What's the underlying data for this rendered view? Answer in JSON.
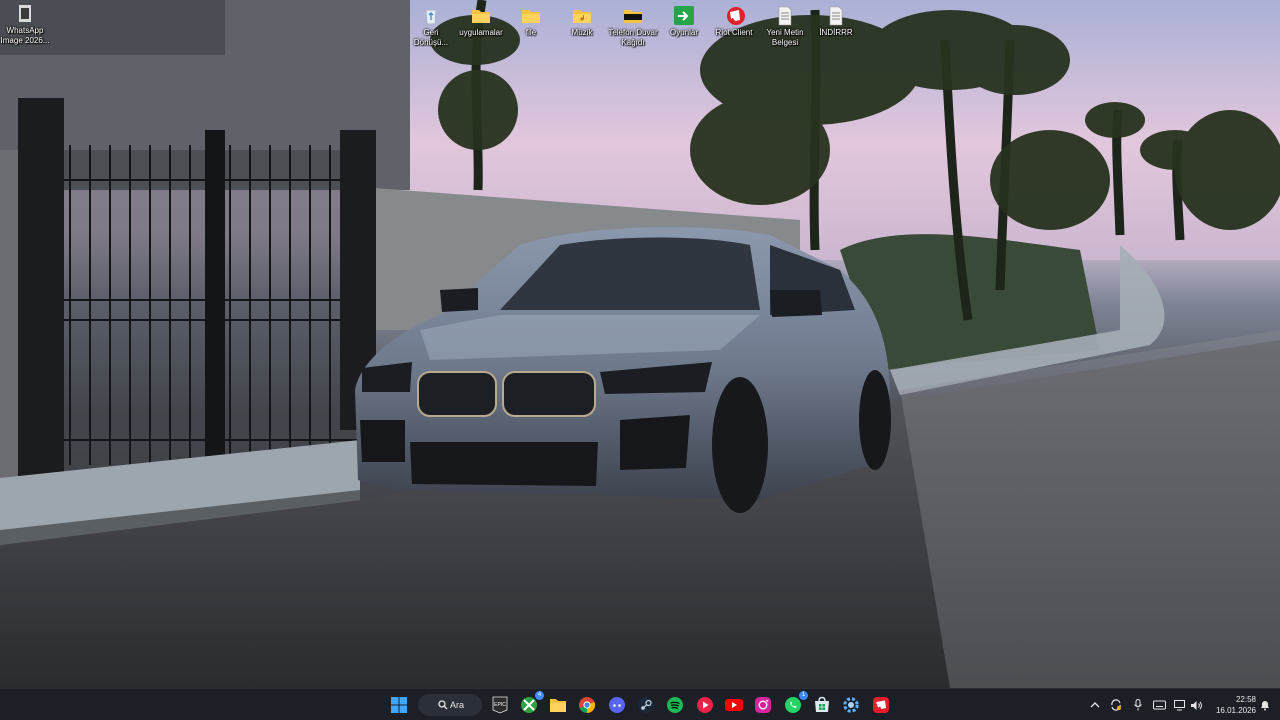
{
  "desktop": {
    "icons": [
      {
        "name": "whatsapp-image-file",
        "label": "WhatsApp Image 2026..."
      },
      {
        "name": "recycle-bin",
        "label": "Geri Dönüşü..."
      },
      {
        "name": "folder-uygulamalar",
        "label": "uygulamalar"
      },
      {
        "name": "folder-file",
        "label": "file"
      },
      {
        "name": "folder-muzik",
        "label": "Müzik"
      },
      {
        "name": "folder-telefon-duvar-kagidi",
        "label": "Telefon Duvar Kağıdı"
      },
      {
        "name": "shortcut-oyunlar",
        "label": "Oyunlar"
      },
      {
        "name": "riot-client",
        "label": "Riot Client"
      },
      {
        "name": "text-document-yeni-metin",
        "label": "Yeni Metin Belgesi"
      },
      {
        "name": "text-document-indirrr",
        "label": "İNDİRRR"
      }
    ]
  },
  "taskbar": {
    "search_label": "Ara",
    "apps": [
      {
        "name": "start-button",
        "icon": "windows-logo-icon"
      },
      {
        "name": "epic-games",
        "icon": "epic-games-icon"
      },
      {
        "name": "xbox",
        "icon": "xbox-icon",
        "badge": "4"
      },
      {
        "name": "file-explorer",
        "icon": "folder-icon"
      },
      {
        "name": "chrome",
        "icon": "chrome-icon"
      },
      {
        "name": "discord",
        "icon": "discord-icon"
      },
      {
        "name": "steam",
        "icon": "steam-icon"
      },
      {
        "name": "spotify",
        "icon": "spotify-icon"
      },
      {
        "name": "media-player",
        "icon": "play-circle-icon"
      },
      {
        "name": "youtube",
        "icon": "youtube-icon"
      },
      {
        "name": "instagram",
        "icon": "instagram-icon"
      },
      {
        "name": "whatsapp",
        "icon": "whatsapp-icon",
        "badge": "1"
      },
      {
        "name": "ms-store",
        "icon": "store-icon"
      },
      {
        "name": "settings-app",
        "icon": "gear-app-icon"
      },
      {
        "name": "riot",
        "icon": "riot-icon"
      }
    ],
    "tray": {
      "time": "22:58",
      "date": "16.01.2026"
    }
  },
  "colors": {
    "taskbar_bg": "#1c1f26",
    "accent": "#3d8bfd",
    "folder_yellow": "#f5c242"
  }
}
